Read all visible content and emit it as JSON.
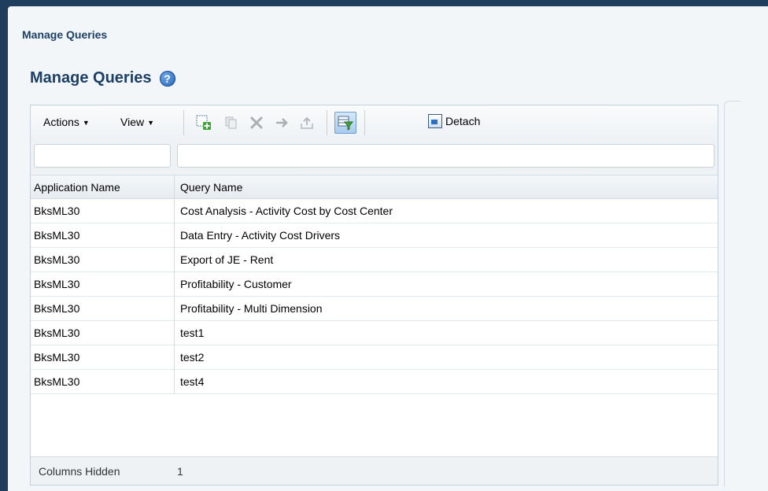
{
  "page": {
    "title": "Manage Queries"
  },
  "panel": {
    "title": "Manage Queries",
    "help_glyph": "?"
  },
  "toolbar": {
    "actions_label": "Actions",
    "view_label": "View",
    "detach_label": "Detach",
    "icons": {
      "create": "create-icon",
      "duplicate": "duplicate-icon",
      "delete": "delete-icon",
      "go_to": "go-to-icon",
      "export": "export-icon",
      "query_by_example": "query-by-example-icon",
      "detach": "detach-icon"
    }
  },
  "table": {
    "columns": [
      "Application Name",
      "Query Name"
    ],
    "rows": [
      [
        "BksML30",
        "Cost Analysis - Activity Cost by Cost Center"
      ],
      [
        "BksML30",
        "Data Entry - Activity Cost Drivers"
      ],
      [
        "BksML30",
        "Export of JE - Rent"
      ],
      [
        "BksML30",
        "Profitability - Customer"
      ],
      [
        "BksML30",
        "Profitability - Multi Dimension"
      ],
      [
        "BksML30",
        "test1"
      ],
      [
        "BksML30",
        "test2"
      ],
      [
        "BksML30",
        "test4"
      ]
    ]
  },
  "footer": {
    "label": "Columns Hidden",
    "value": "1"
  },
  "colors": {
    "title": "#1c3f66",
    "frame": "#1f3d5c",
    "background": "#f3f6f9"
  }
}
